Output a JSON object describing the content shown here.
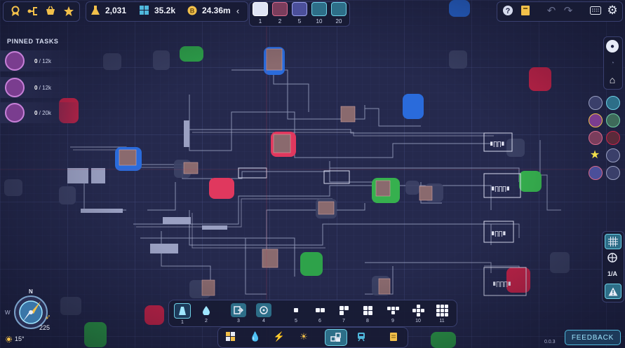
{
  "toolbar": {
    "left_icons": [
      "milestones-icon",
      "research-icon",
      "shop-icon",
      "achievements-icon"
    ],
    "resources": [
      {
        "icon": "flask-icon",
        "value": "2,031",
        "color": "#f2c04a"
      },
      {
        "icon": "shapes-icon",
        "value": "35.2k",
        "color": "#4fb8dc"
      },
      {
        "icon": "coin-icon",
        "value": "24.36m",
        "color": "#f2c04a"
      }
    ],
    "speeds": [
      "1",
      "2",
      "5",
      "10",
      "20"
    ],
    "right_icons": [
      "help-icon",
      "blueprint-icon",
      "undo-icon",
      "redo-icon",
      "keyboard-icon",
      "settings-icon"
    ]
  },
  "pinned": {
    "title": "PINNED TASKS",
    "tasks": [
      {
        "progress": "0",
        "target": "12k"
      },
      {
        "progress": "0",
        "target": "12k"
      },
      {
        "progress": "0",
        "target": "20k"
      }
    ]
  },
  "right_panel": {
    "layer_label": "1/A"
  },
  "compass": {
    "north": "N",
    "west": "W",
    "value": "225",
    "angle": "15°"
  },
  "build_bar": {
    "slots": [
      {
        "num": "1",
        "icon": "extractor-icon"
      },
      {
        "num": "2",
        "icon": "pump-icon"
      },
      {
        "num": "3",
        "icon": "sender-icon"
      },
      {
        "num": "4",
        "icon": "receiver-icon"
      },
      {
        "num": "5",
        "icon": "shape-1"
      },
      {
        "num": "6",
        "icon": "shape-2"
      },
      {
        "num": "7",
        "icon": "shape-3"
      },
      {
        "num": "8",
        "icon": "shape-4"
      },
      {
        "num": "9",
        "icon": "shape-5"
      },
      {
        "num": "10",
        "icon": "shape-6"
      },
      {
        "num": "11",
        "icon": "shape-7"
      }
    ]
  },
  "categories": [
    "shapes-icon",
    "fluids-icon",
    "energy-icon",
    "weather-icon",
    "blueprint-icon",
    "train-icon",
    "notes-icon"
  ],
  "feedback_label": "FEEDBACK",
  "version": "0.0.3"
}
